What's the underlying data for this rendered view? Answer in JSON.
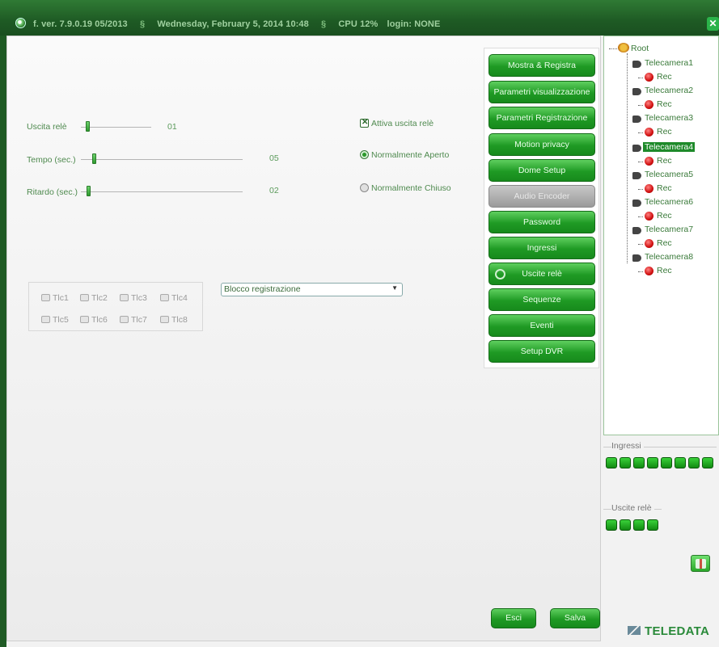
{
  "titlebar": {
    "version": "f. ver. 7.9.0.19  05/2013",
    "separator": "§",
    "datetime": "Wednesday, February 5, 2014  10:48",
    "cpu": "CPU 12%",
    "login": "login: NONE",
    "close": "✕"
  },
  "form": {
    "uscita_rele": {
      "label": "Uscita relè",
      "value": "01"
    },
    "tempo": {
      "label": "Tempo (sec.)",
      "value": "05"
    },
    "ritardo": {
      "label": "Ritardo (sec.)",
      "value": "02"
    },
    "attiva_uscita": {
      "label": "Attiva uscita relè",
      "checked": true
    },
    "normalmente_aperto": {
      "label": "Normalmente Aperto",
      "selected": true
    },
    "normalmente_chiuso": {
      "label": "Normalmente Chiuso",
      "selected": false
    },
    "tlc": [
      "Tlc1",
      "Tlc2",
      "Tlc3",
      "Tlc4",
      "Tlc5",
      "Tlc6",
      "Tlc7",
      "Tlc8"
    ],
    "select_value": "Blocco registrazione"
  },
  "menu": [
    {
      "label": "Mostra & Registra",
      "enabled": true
    },
    {
      "label": "Parametri visualizzazione",
      "enabled": true
    },
    {
      "label": "Parametri Registrazione",
      "enabled": true
    },
    {
      "label": "Motion privacy",
      "enabled": true
    },
    {
      "label": "Dome Setup",
      "enabled": true
    },
    {
      "label": "Audio Encoder",
      "enabled": false
    },
    {
      "label": "Password",
      "enabled": true
    },
    {
      "label": "Ingressi",
      "enabled": true
    },
    {
      "label": "Uscite relè",
      "enabled": true,
      "active": true
    },
    {
      "label": "Sequenze",
      "enabled": true
    },
    {
      "label": "Eventi",
      "enabled": true
    },
    {
      "label": "Setup DVR",
      "enabled": true
    }
  ],
  "buttons": {
    "esci": "Esci",
    "salva": "Salva"
  },
  "tree": {
    "root": "Root",
    "cameras": [
      "Telecamera1",
      "Telecamera2",
      "Telecamera3",
      "Telecamera4",
      "Telecamera5",
      "Telecamera6",
      "Telecamera7",
      "Telecamera8"
    ],
    "rec": "Rec",
    "selected": "Telecamera4"
  },
  "status": {
    "ingressi_label": "Ingressi",
    "ingressi_count": 8,
    "uscite_label": "Uscite relè",
    "uscite_count": 4
  },
  "brand": "TELEDATA"
}
